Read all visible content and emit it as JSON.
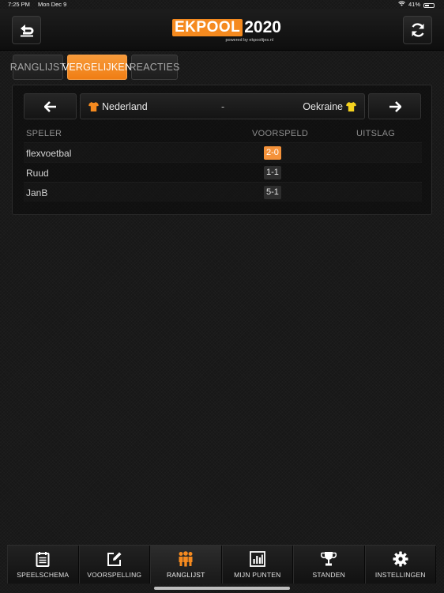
{
  "status_bar": {
    "time": "7:25 PM",
    "date": "Mon Dec 9",
    "battery": "41%"
  },
  "header": {
    "logo_ek": "EKPOOL",
    "logo_year": "2020",
    "logo_sub": "powered by ekpooltjes.nl"
  },
  "tabs": [
    {
      "label": "RANGLIJST",
      "active": false
    },
    {
      "label": "VERGELIJKEN",
      "active": true
    },
    {
      "label": "REACTIES",
      "active": false
    }
  ],
  "match": {
    "home": "Nederland",
    "separator": "-",
    "away": "Oekraine",
    "home_shirt_color": "#f58a1f",
    "away_shirt_color": "#f5d21f"
  },
  "table": {
    "headers": {
      "player": "SPELER",
      "prediction": "VOORSPELD",
      "result": "UITSLAG"
    },
    "rows": [
      {
        "player": "flexvoetbal",
        "prediction": "2-0",
        "result": "",
        "highlight": true
      },
      {
        "player": "Ruud",
        "prediction": "1-1",
        "result": "",
        "highlight": false
      },
      {
        "player": "JanB",
        "prediction": "5-1",
        "result": "",
        "highlight": false
      }
    ]
  },
  "bottom_nav": [
    {
      "label": "SPEELSCHEMA",
      "icon": "calendar-icon"
    },
    {
      "label": "VOORSPELLING",
      "icon": "edit-icon"
    },
    {
      "label": "RANGLIJST",
      "icon": "people-icon",
      "active": true
    },
    {
      "label": "MIJN PUNTEN",
      "icon": "bar-chart-icon"
    },
    {
      "label": "STANDEN",
      "icon": "trophy-icon"
    },
    {
      "label": "INSTELLINGEN",
      "icon": "gear-icon"
    }
  ],
  "colors": {
    "accent": "#f58a1f",
    "background": "#171717"
  }
}
